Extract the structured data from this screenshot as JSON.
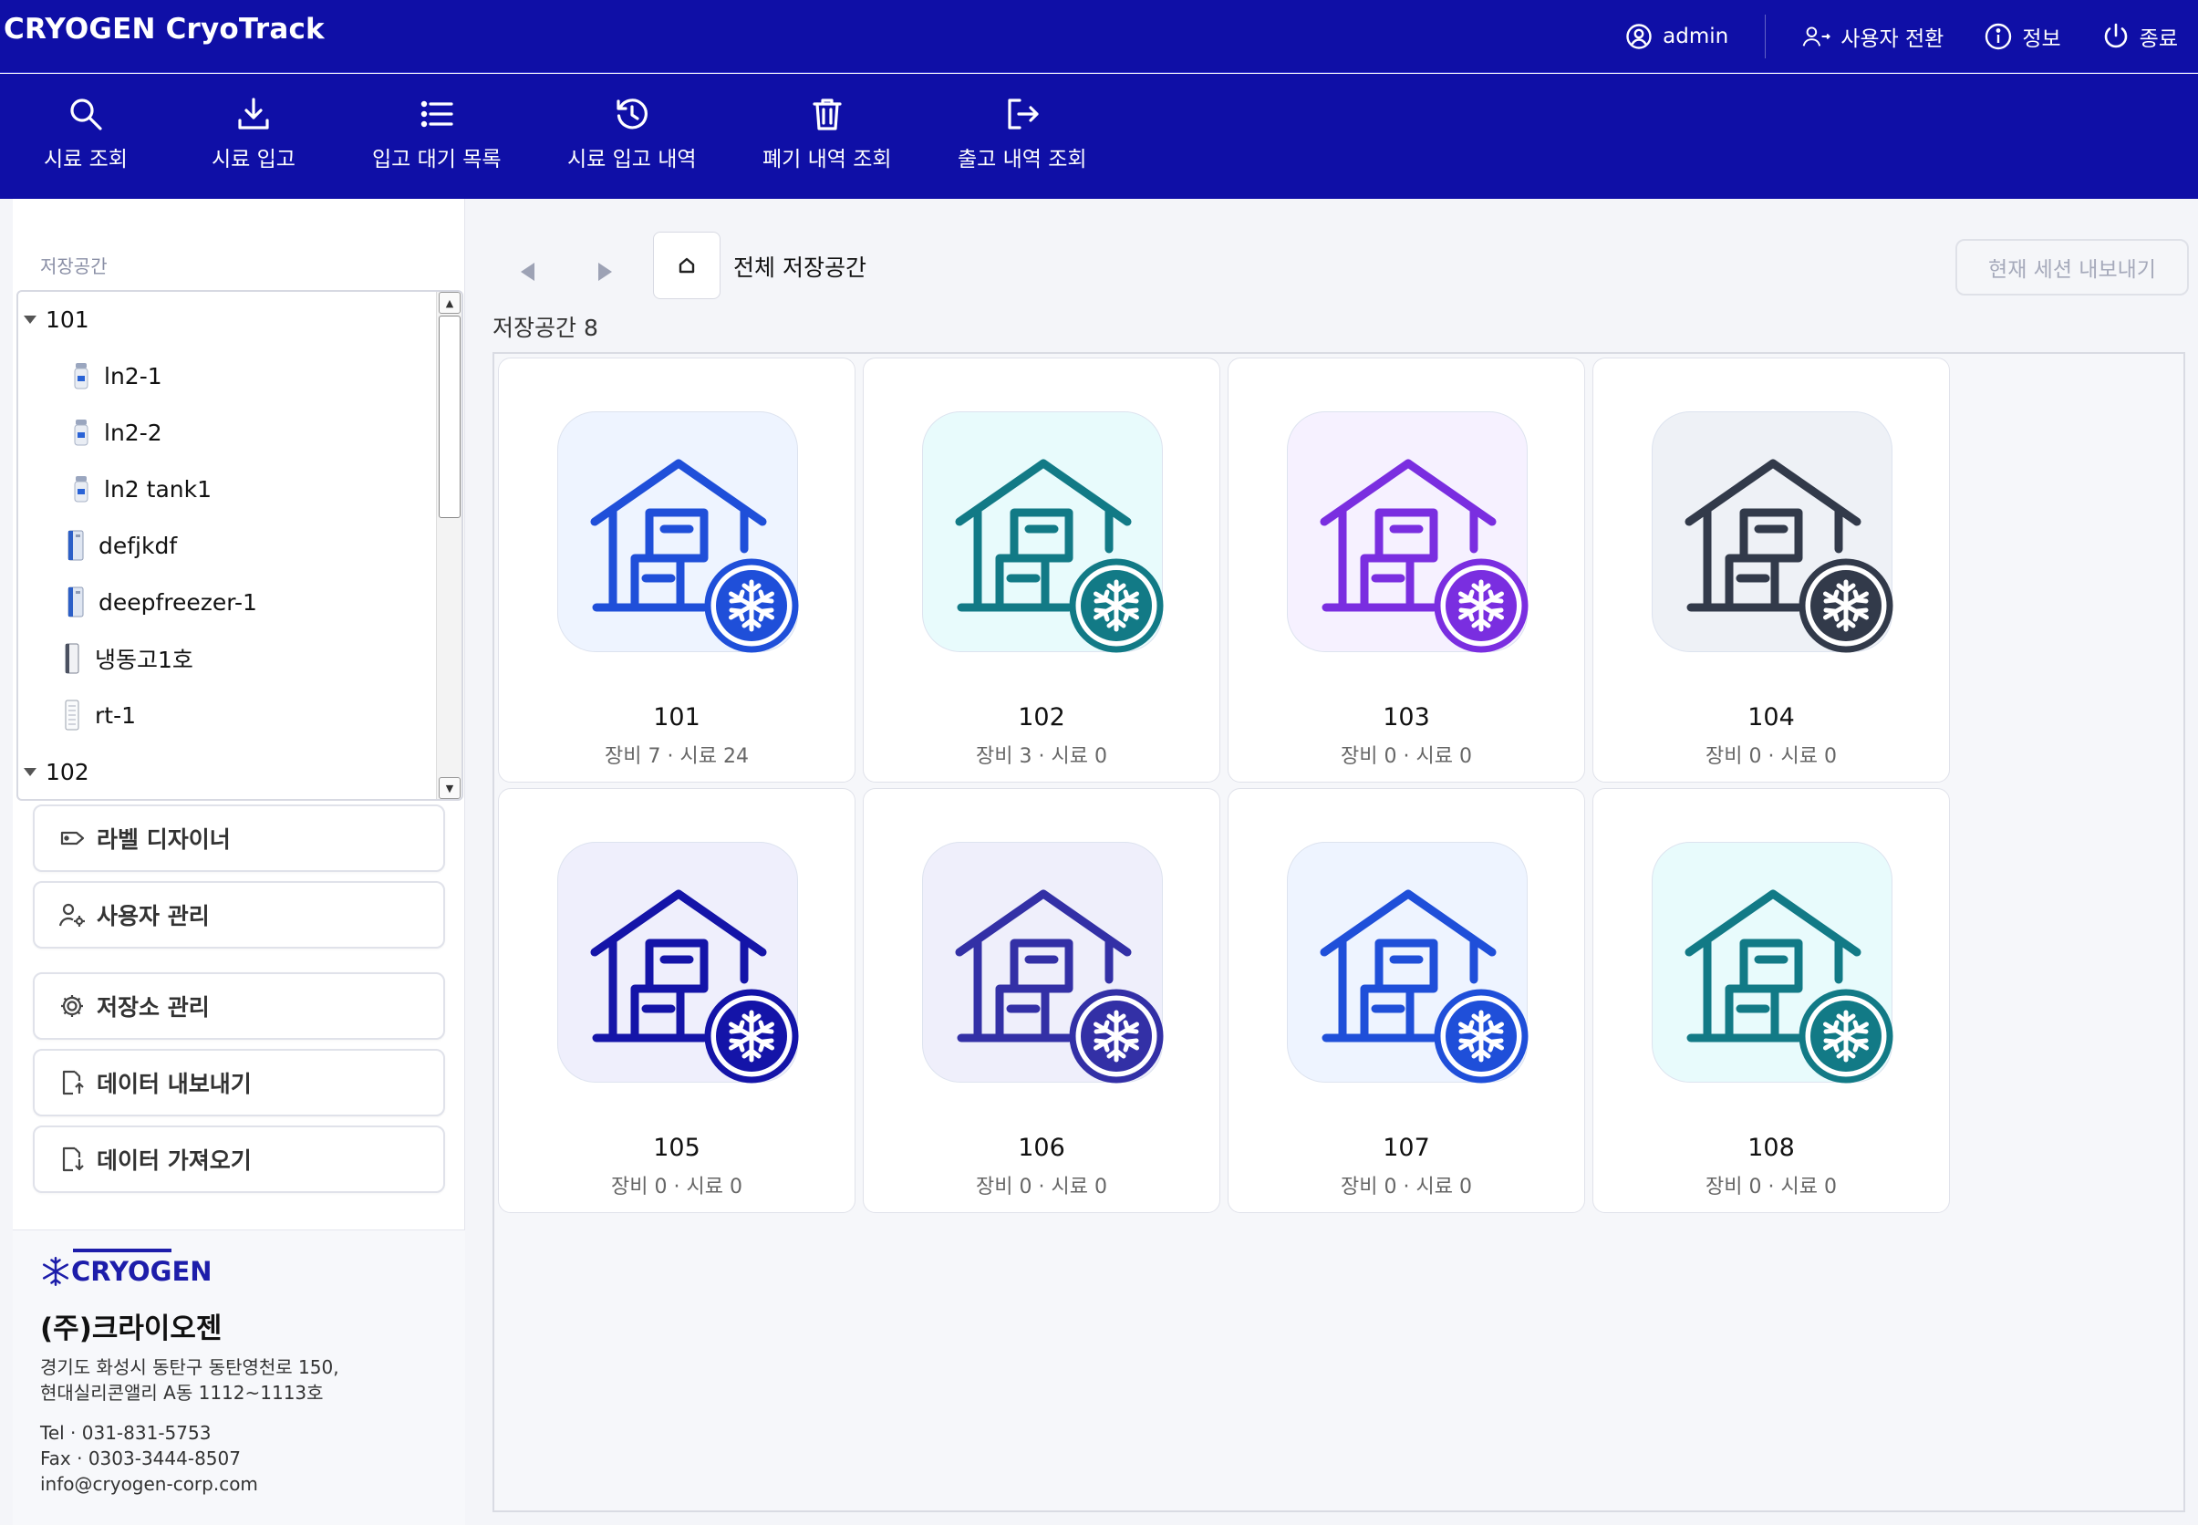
{
  "app": {
    "title": "CRYOGEN CryoTrack"
  },
  "topbar": {
    "user": "admin",
    "switch_user": "사용자 전환",
    "info": "정보",
    "exit": "종료"
  },
  "toolbar": [
    {
      "label": "시료 조회",
      "icon": "search-icon"
    },
    {
      "label": "시료 입고",
      "icon": "download-icon"
    },
    {
      "label": "입고 대기 목록",
      "icon": "list-icon"
    },
    {
      "label": "시료 입고 내역",
      "icon": "history-icon"
    },
    {
      "label": "폐기 내역 조회",
      "icon": "trash-icon"
    },
    {
      "label": "출고 내역 조회",
      "icon": "logout-icon"
    }
  ],
  "sidebar": {
    "section_label": "저장공간",
    "tree": [
      {
        "label": "101",
        "type": "group",
        "icon": "caret-down-icon"
      },
      {
        "label": "ln2-1",
        "type": "device",
        "icon": "ln2-tank-icon"
      },
      {
        "label": "ln2-2",
        "type": "device",
        "icon": "ln2-tank-icon"
      },
      {
        "label": "ln2 tank1",
        "type": "device",
        "icon": "ln2-tank-icon"
      },
      {
        "label": "defjkdf",
        "type": "device",
        "icon": "deep-freezer-icon"
      },
      {
        "label": "deepfreezer-1",
        "type": "device",
        "icon": "deep-freezer-icon"
      },
      {
        "label": "냉동고1호",
        "type": "device",
        "icon": "freezer-icon"
      },
      {
        "label": "rt-1",
        "type": "device",
        "icon": "rt-cabinet-icon"
      },
      {
        "label": "102",
        "type": "group",
        "icon": "caret-down-icon"
      }
    ],
    "buttons": [
      {
        "label": "라벨 디자이너",
        "icon": "label-icon"
      },
      {
        "label": "사용자 관리",
        "icon": "user-gear-icon"
      },
      {
        "label": "저장소 관리",
        "icon": "gear-icon"
      },
      {
        "label": "데이터 내보내기",
        "icon": "file-export-icon"
      },
      {
        "label": "데이터 가져오기",
        "icon": "file-import-icon"
      }
    ],
    "company": {
      "logo_text": "CRYOGEN",
      "name": "(주)크라이오젠",
      "address_line1": "경기도 화성시 동탄구 동탄영천로 150,",
      "address_line2": "현대실리콘앨리 A동 1112~1113호",
      "tel": "Tel · 031-831-5753",
      "fax": "Fax · 0303-3444-8507",
      "email": "info@cryogen-corp.com"
    }
  },
  "main": {
    "path_label": "전체 저장공간",
    "export_session": "현재 세션 내보내기",
    "storage_count": "저장공간 8",
    "cards": [
      {
        "name": "101",
        "sub": "장비 7 · 시료 24",
        "color": "#1f4fd9",
        "bg": "#eef4ff"
      },
      {
        "name": "102",
        "sub": "장비 3 · 시료 0",
        "color": "#127a86",
        "bg": "#e8fbfc"
      },
      {
        "name": "103",
        "sub": "장비 0 · 시료 0",
        "color": "#7a2ee0",
        "bg": "#f6f1ff"
      },
      {
        "name": "104",
        "sub": "장비 0 · 시료 0",
        "color": "#323a4a",
        "bg": "#eef1f6"
      },
      {
        "name": "105",
        "sub": "장비 0 · 시료 0",
        "color": "#1414a8",
        "bg": "#efeffc"
      },
      {
        "name": "106",
        "sub": "장비 0 · 시료 0",
        "color": "#3330a6",
        "bg": "#efeffb"
      },
      {
        "name": "107",
        "sub": "장비 0 · 시료 0",
        "color": "#1f4fd9",
        "bg": "#eef4ff"
      },
      {
        "name": "108",
        "sub": "장비 0 · 시료 0",
        "color": "#127a86",
        "bg": "#e8fbfc"
      }
    ]
  }
}
